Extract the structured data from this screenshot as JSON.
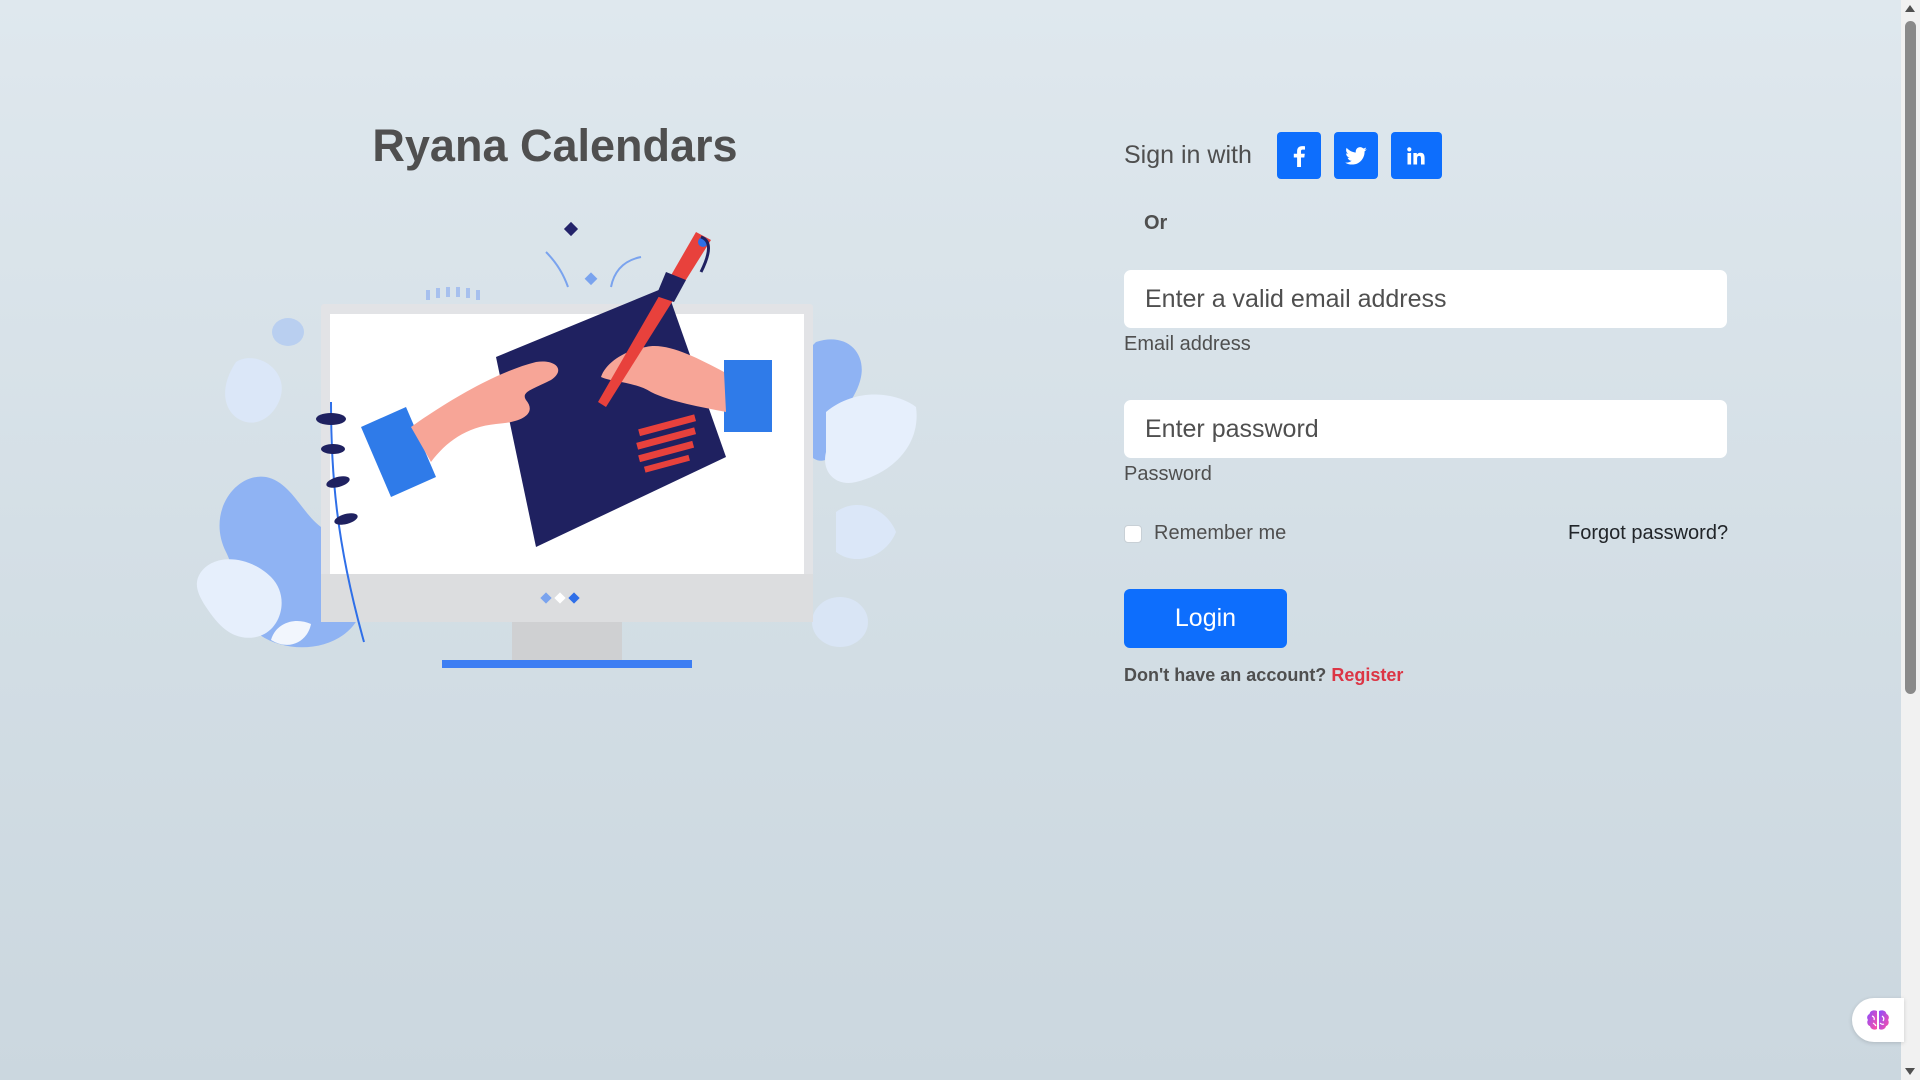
{
  "brand": {
    "title": "Ryana Calendars"
  },
  "social": {
    "label": "Sign in with",
    "buttons": [
      "facebook-icon",
      "twitter-icon",
      "linkedin-icon"
    ],
    "color": "#0d6efd"
  },
  "divider": {
    "text": "Or"
  },
  "form": {
    "email": {
      "placeholder": "Enter a valid email address",
      "label": "Email address",
      "value": ""
    },
    "password": {
      "placeholder": "Enter password",
      "label": "Password",
      "value": ""
    },
    "remember": {
      "label": "Remember me",
      "checked": false
    },
    "forgot_link": "Forgot password?",
    "login_label": "Login"
  },
  "register": {
    "prompt": "Don't have an account?",
    "link": "Register",
    "link_color": "#dc3545"
  },
  "colors": {
    "primary": "#0d6efd",
    "text": "#4f4f4f",
    "background": "#d7e1e8"
  },
  "widget": {
    "icon": "brain-icon"
  }
}
